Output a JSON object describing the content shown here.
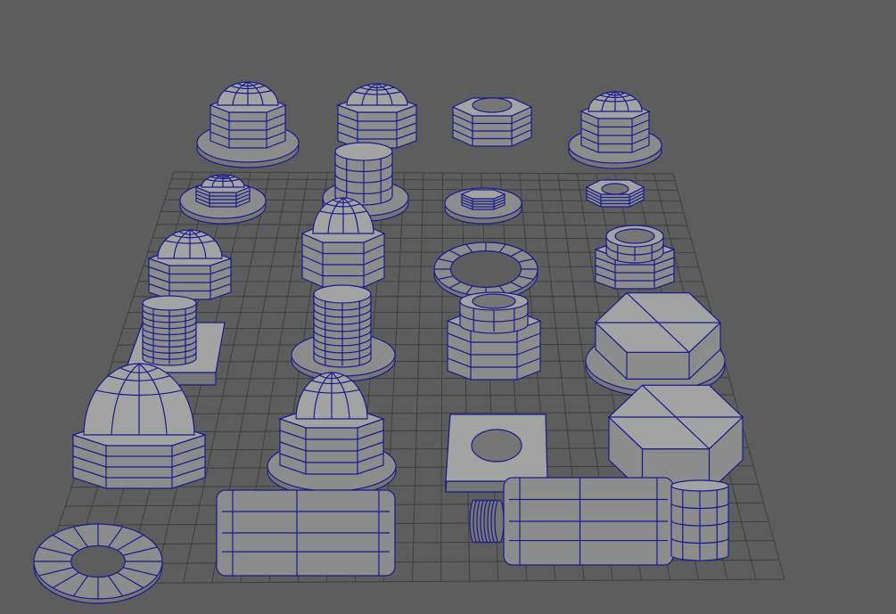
{
  "viewport": {
    "background_color": "#5d5d5d",
    "grid_color": "#3f3f3f",
    "mesh_fill_color": "#8c8c8c",
    "mesh_shade_color": "#767676",
    "mesh_light_color": "#a3a3a3",
    "wireframe_color": "#1a1a8c"
  }
}
